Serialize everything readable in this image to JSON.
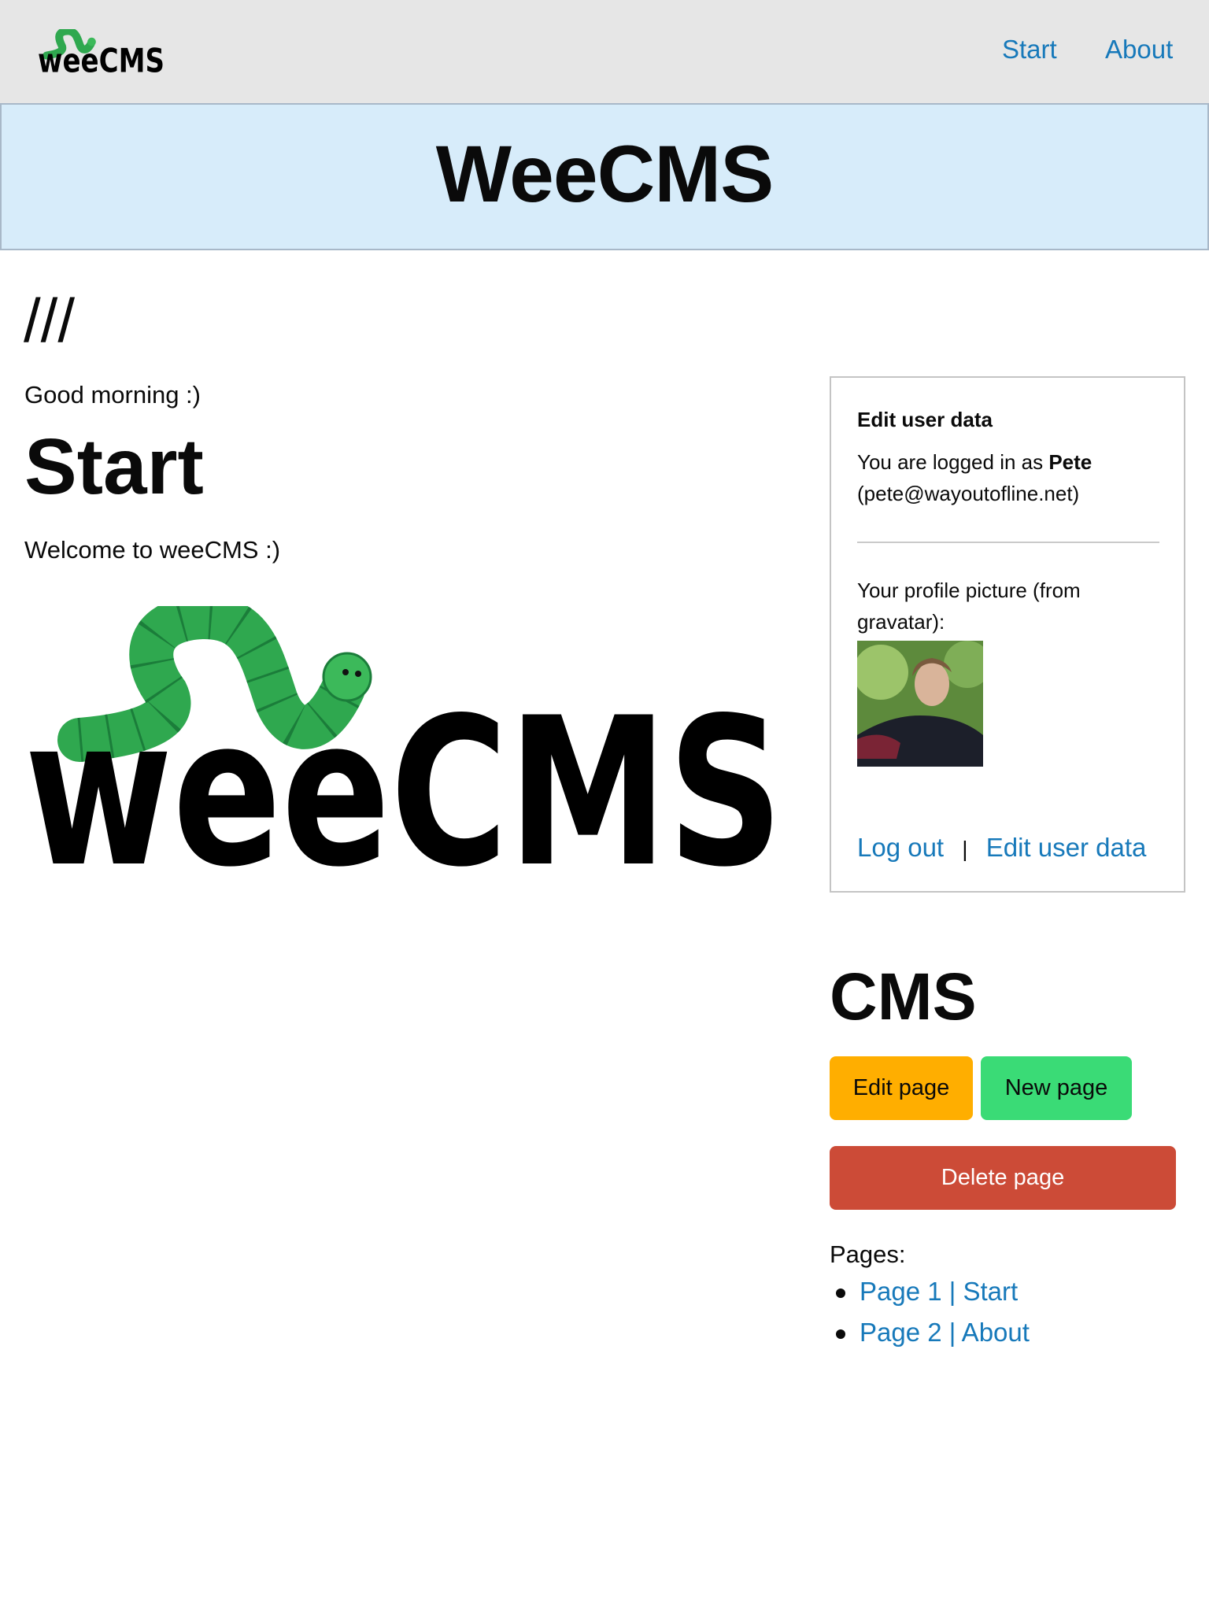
{
  "nav": {
    "logo_text": "weeCMS",
    "links": [
      {
        "label": "Start"
      },
      {
        "label": "About"
      }
    ]
  },
  "banner": {
    "title": "WeeCMS"
  },
  "main": {
    "breadcrumb": "///",
    "greeting": "Good morning :)",
    "title": "Start",
    "body": "Welcome to weeCMS :)",
    "logo_text": "weeCMS"
  },
  "user_box": {
    "heading": "Edit user data",
    "logged_in_prefix": "You are logged in as ",
    "username": "Pete",
    "email": "(pete@wayoutofline.net)",
    "profile_line1": "Your profile picture (from",
    "profile_line2": "gravatar):",
    "logout": "Log out",
    "separator": "|",
    "edit_user": "Edit user data"
  },
  "cms": {
    "title": "CMS",
    "edit_page": "Edit page",
    "new_page": "New page",
    "delete_page": "Delete page",
    "pages_label": "Pages:",
    "pages": [
      {
        "label": "Page 1 | Start"
      },
      {
        "label": "Page 2 | About"
      }
    ]
  },
  "colors": {
    "link": "#1779ba",
    "topbar": "#e6e6e6",
    "banner": "#d7ecfa",
    "edit": "#ffae00",
    "new": "#3adb76",
    "delete": "#cc4b37",
    "logo_green": "#2fa84f"
  }
}
